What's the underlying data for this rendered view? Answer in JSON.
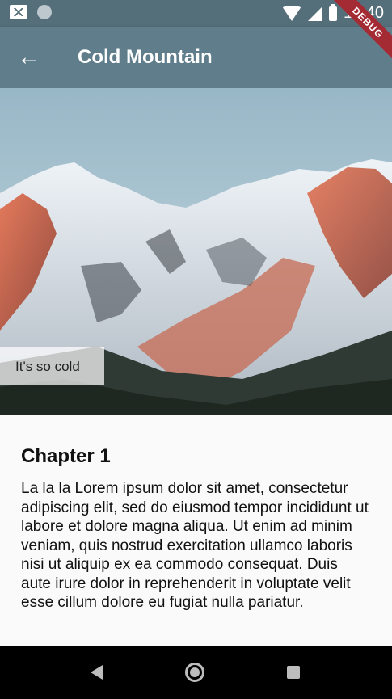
{
  "status_bar": {
    "time": "12:40",
    "icons": [
      "gmail-icon",
      "circle-icon",
      "wifi-icon",
      "signal-icon",
      "battery-icon"
    ]
  },
  "app_bar": {
    "title": "Cold Mountain",
    "back_icon": "arrow-back-icon",
    "color": "#607d8b"
  },
  "debug_banner": "DEBUG",
  "hero": {
    "image": "snowy-mountain-image",
    "caption": "It's so cold"
  },
  "content": {
    "chapter_title": "Chapter 1",
    "body": "La la la Lorem ipsum dolor sit amet, consectetur adipiscing elit, sed do eiusmod tempor incididunt ut labore et dolore magna aliqua. Ut enim ad minim veniam, quis nostrud exercitation ullamco laboris nisi ut aliquip ex ea commodo consequat. Duis aute irure dolor in reprehenderit in voluptate velit esse cillum dolore eu fugiat nulla pariatur."
  },
  "nav_bar": {
    "icons": [
      "nav-back-icon",
      "nav-home-icon",
      "nav-recent-icon"
    ]
  }
}
